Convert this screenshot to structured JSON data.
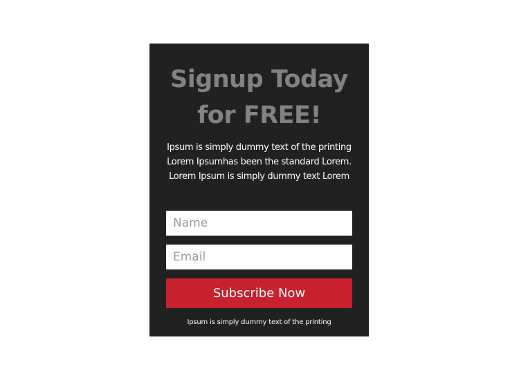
{
  "signup": {
    "title_line1": "Signup Today",
    "title_line2": "for FREE!",
    "description_lines": [
      "Ipsum is simply dummy text of the printing",
      "Lorem Ipsumhas been the standard Lorem.",
      "Lorem Ipsum is simply dummy text Lorem"
    ],
    "name_field": {
      "placeholder": "Name",
      "value": ""
    },
    "email_field": {
      "placeholder": "Email",
      "value": ""
    },
    "subscribe_label": "Subscribe Now",
    "footnote": "Ipsum is simply dummy text of the printing"
  },
  "colors": {
    "card_background": "#212121",
    "title": "#828282",
    "button": "#c9222f",
    "page_background": "#ffffff"
  }
}
